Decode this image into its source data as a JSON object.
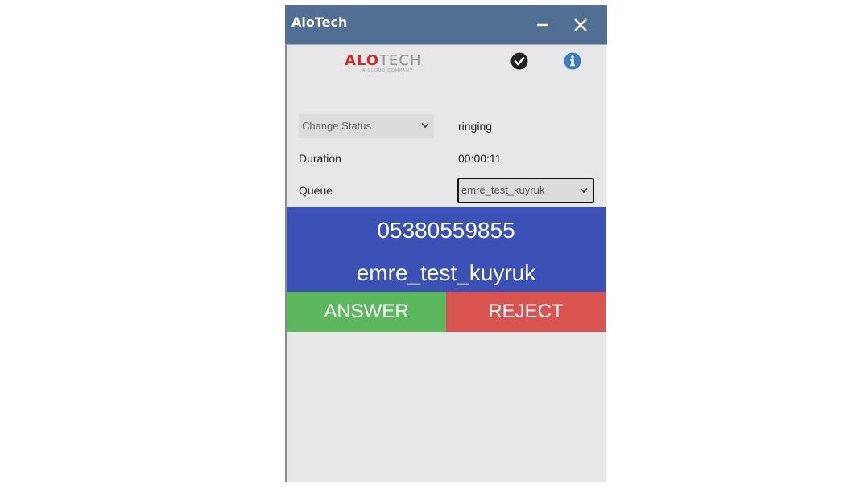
{
  "window": {
    "title": "AloTech"
  },
  "logo": {
    "part1": "ALO",
    "part2": "TECH",
    "tagline": "A CLOUD COMPANY"
  },
  "icons": {
    "minimize": "minimize-icon",
    "close": "close-icon",
    "status": "check-circle-icon",
    "info": "info-circle-icon"
  },
  "form": {
    "status_select": "Change Status",
    "status_value": "ringing",
    "duration_label": "Duration",
    "duration_value": "00:00:11",
    "queue_label": "Queue",
    "queue_select": "emre_test_kuyruk"
  },
  "call": {
    "number": "05380559855",
    "queue": "emre_test_kuyruk",
    "answer_label": "ANSWER",
    "reject_label": "REJECT"
  },
  "colors": {
    "titlebar": "#516f92",
    "call_panel": "#3c51b5",
    "answer": "#5cb85c",
    "reject": "#d9534f"
  }
}
